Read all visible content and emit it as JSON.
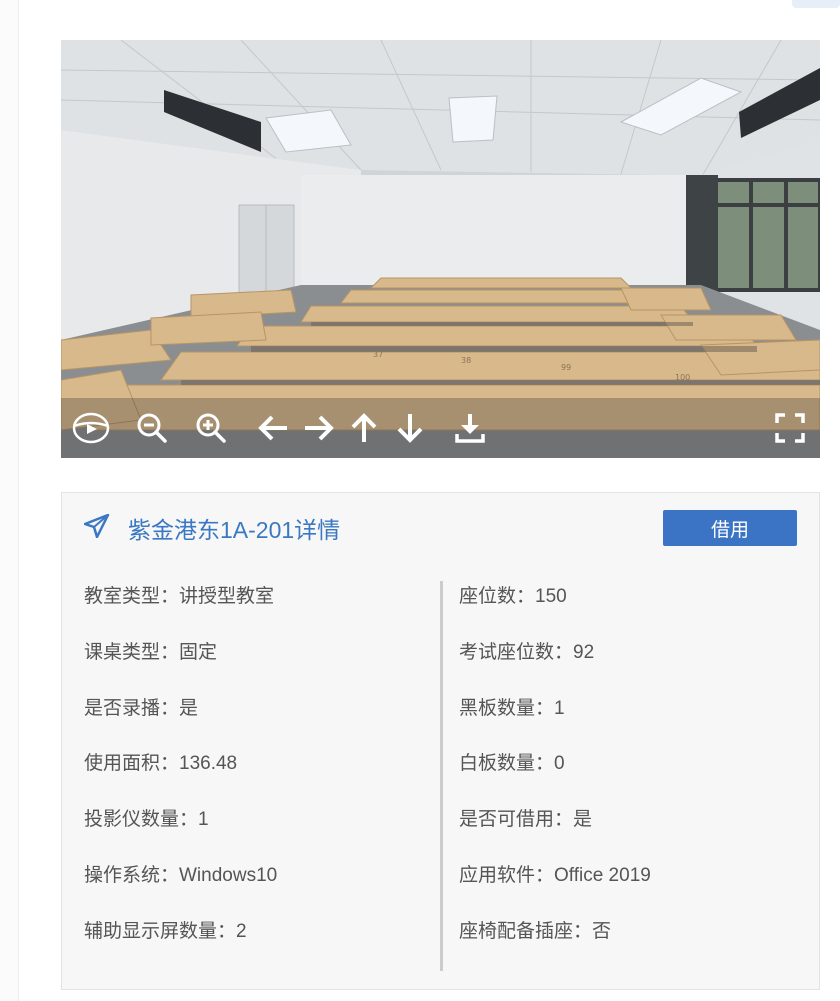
{
  "viewer": {
    "toolbar": {
      "buttons": [
        {
          "name": "autorotate-icon"
        },
        {
          "name": "zoom-out-icon"
        },
        {
          "name": "zoom-in-icon"
        },
        {
          "name": "arrow-left-icon"
        },
        {
          "name": "arrow-right-icon"
        },
        {
          "name": "arrow-up-icon"
        },
        {
          "name": "arrow-down-icon"
        },
        {
          "name": "download-icon"
        },
        {
          "name": "fullscreen-icon"
        }
      ]
    },
    "seat_labels": [
      "37",
      "38",
      "99",
      "100"
    ]
  },
  "detail": {
    "title": "紫金港东1A-201详情",
    "borrow_label": "借用",
    "left": [
      "教室类型：讲授型教室",
      "课桌类型：固定",
      "是否录播：是",
      "使用面积：136.48",
      "投影仪数量：1",
      "操作系统：Windows10",
      "辅助显示屏数量：2"
    ],
    "right": [
      "座位数：150",
      "考试座位数：92",
      "黑板数量：1",
      "白板数量：0",
      "是否可借用：是",
      "应用软件：Office 2019",
      "座椅配备插座：否"
    ]
  },
  "colors": {
    "accent": "#3a78c3",
    "button": "#3b74c4",
    "card_bg": "#f7f7f7",
    "text": "#555555"
  }
}
